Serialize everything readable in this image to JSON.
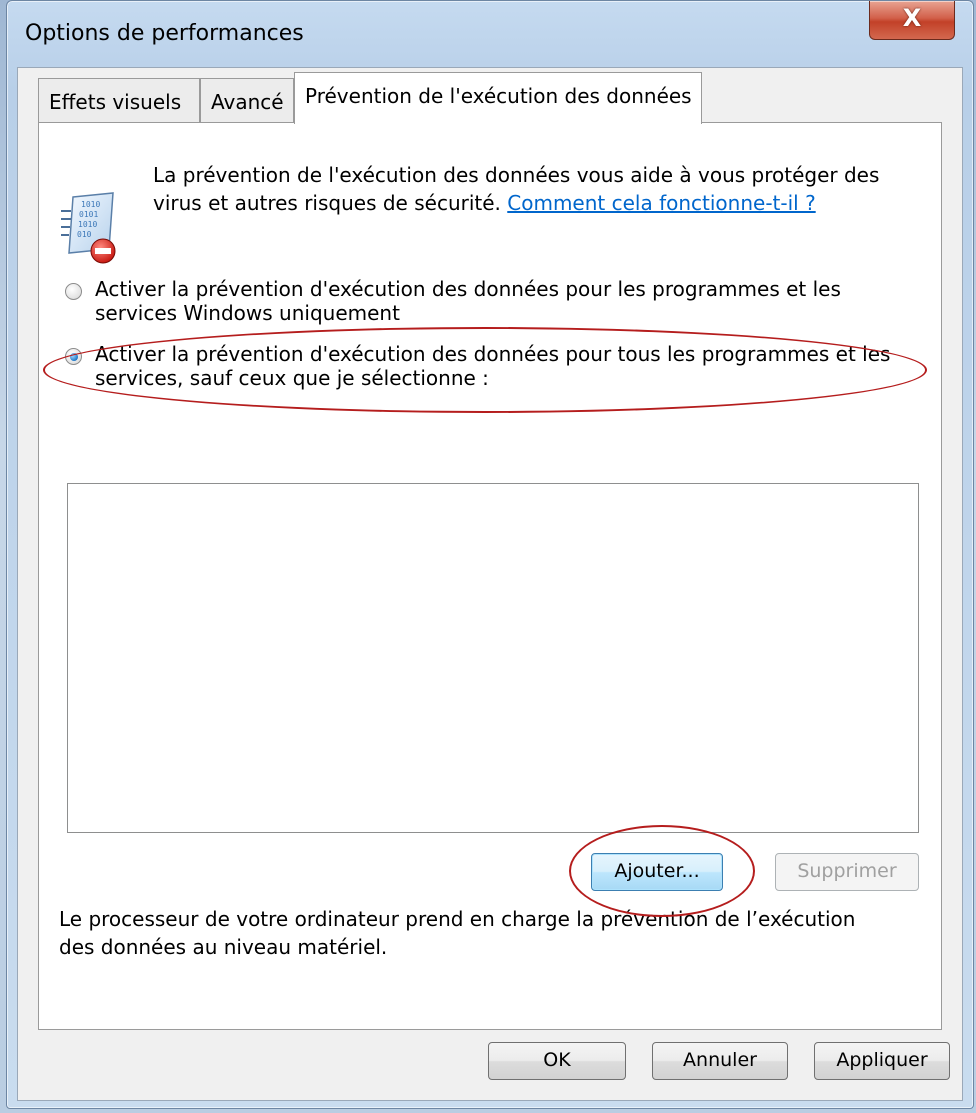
{
  "window": {
    "title": "Options de performances",
    "close_label": "X"
  },
  "tabs": [
    {
      "label": "Effets visuels",
      "active": false
    },
    {
      "label": "Avancé",
      "active": false
    },
    {
      "label": "Prévention de l'exécution des données",
      "active": true
    }
  ],
  "dep": {
    "intro_text": "La prévention de l'exécution des données vous aide à vous protéger des virus et autres risques de sécurité.",
    "intro_link": "Comment cela fonctionne-t-il ?",
    "option1_label": "Activer la prévention d'exécution des données pour les programmes et les services Windows uniquement",
    "option1_checked": false,
    "option2_label": "Activer la prévention d'exécution des données pour tous les programmes et les services, sauf ceux que je sélectionne :",
    "option2_checked": true,
    "add_button": "Ajouter...",
    "remove_button": "Supprimer",
    "hardware_note": "Le processeur de votre ordinateur prend en charge la prévention de l’exécution des données au niveau matériel."
  },
  "footer": {
    "ok": "OK",
    "cancel": "Annuler",
    "apply": "Appliquer"
  },
  "annotation_color": "#b51d1d"
}
